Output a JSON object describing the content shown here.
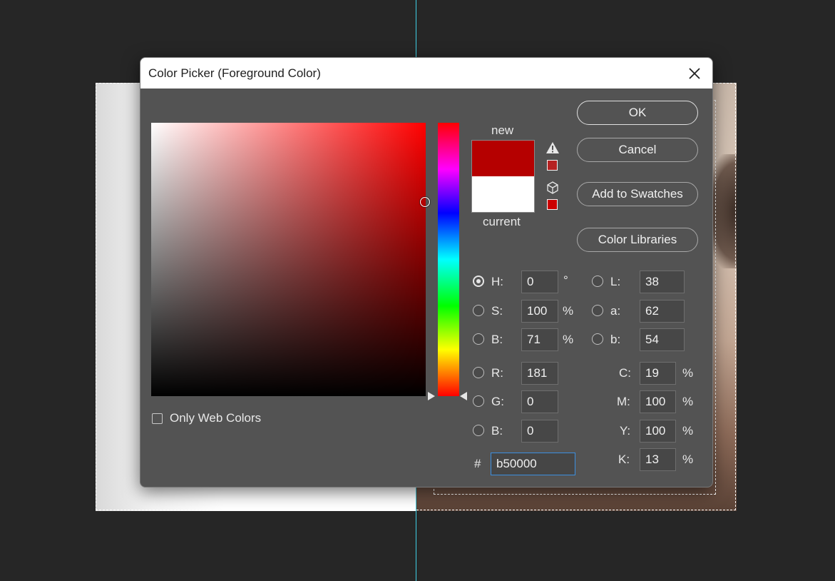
{
  "dialog": {
    "title": "Color Picker (Foreground Color)"
  },
  "buttons": {
    "ok": "OK",
    "cancel": "Cancel",
    "add_to_swatches": "Add to Swatches",
    "color_libraries": "Color Libraries"
  },
  "preview": {
    "new_label": "new",
    "current_label": "current",
    "new_color": "#b50000",
    "current_color": "#ffffff",
    "gamut_warning_color": "#b62222",
    "web_safe_color": "#cc0000"
  },
  "options": {
    "only_web_colors": "Only Web Colors",
    "only_web_colors_checked": false
  },
  "hsb": {
    "h": {
      "label": "H:",
      "value": "0",
      "unit": "°",
      "selected": true
    },
    "s": {
      "label": "S:",
      "value": "100",
      "unit": "%",
      "selected": false
    },
    "b": {
      "label": "B:",
      "value": "71",
      "unit": "%",
      "selected": false
    }
  },
  "rgb": {
    "r": {
      "label": "R:",
      "value": "181",
      "selected": false
    },
    "g": {
      "label": "G:",
      "value": "0",
      "selected": false
    },
    "b": {
      "label": "B:",
      "value": "0",
      "selected": false
    }
  },
  "lab": {
    "l": {
      "label": "L:",
      "value": "38",
      "selected": false
    },
    "a": {
      "label": "a:",
      "value": "62",
      "selected": false
    },
    "b": {
      "label": "b:",
      "value": "54",
      "selected": false
    }
  },
  "cmyk": {
    "c": {
      "label": "C:",
      "value": "19",
      "unit": "%"
    },
    "m": {
      "label": "M:",
      "value": "100",
      "unit": "%"
    },
    "y": {
      "label": "Y:",
      "value": "100",
      "unit": "%"
    },
    "k": {
      "label": "K:",
      "value": "13",
      "unit": "%"
    }
  },
  "hex": {
    "label": "#",
    "value": "b50000"
  },
  "picker": {
    "hue_degrees": 0,
    "saturation": 1.0,
    "brightness": 0.71
  }
}
